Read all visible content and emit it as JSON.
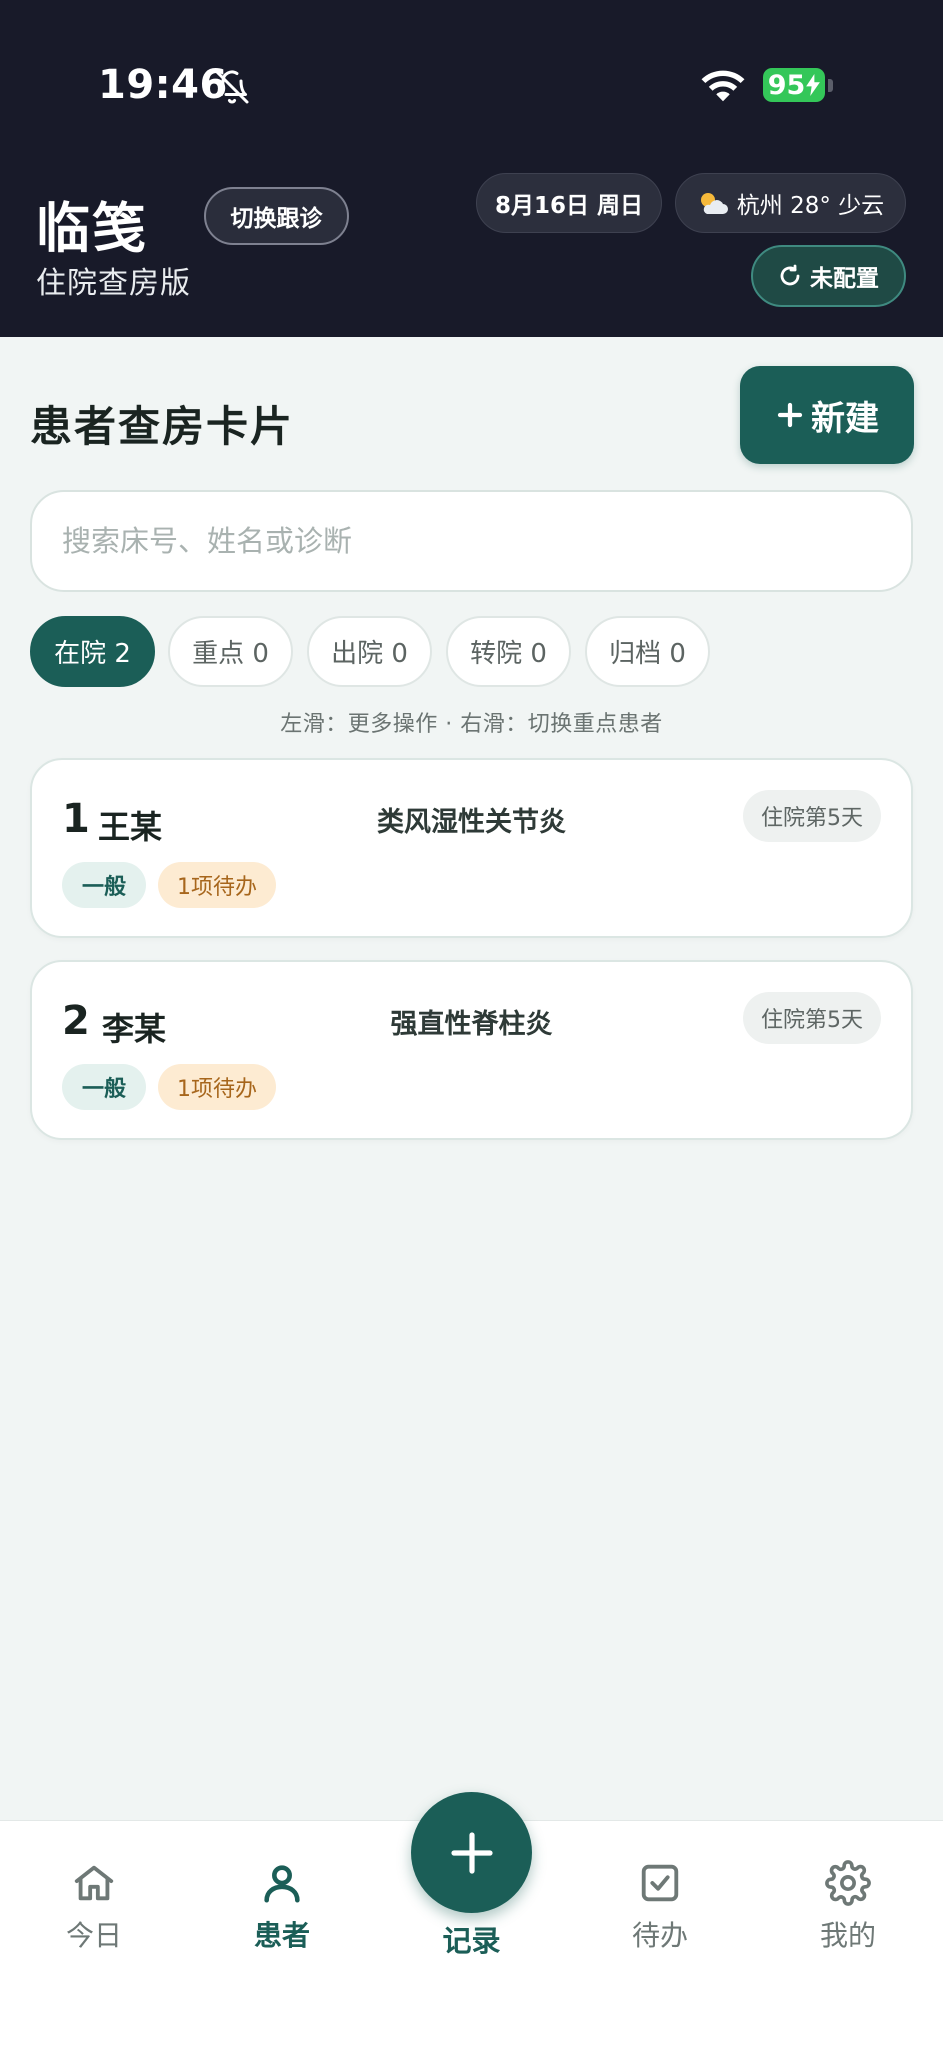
{
  "status_bar": {
    "time": "19:46",
    "battery": "95",
    "icons": [
      "bell-off-icon",
      "wifi-icon",
      "battery-icon",
      "bolt-icon"
    ]
  },
  "header": {
    "title": "临笺",
    "subtitle": "住院查房版",
    "switch_button": "切换跟诊",
    "date": "8月16日 周日",
    "weather": "杭州 28° 少云",
    "config_button": "未配置"
  },
  "main": {
    "section_title": "患者查房卡片",
    "new_button": "新建",
    "search": {
      "placeholder": "搜索床号、姓名或诊断",
      "value": ""
    },
    "filters": [
      {
        "label": "在院 2",
        "active": true
      },
      {
        "label": "重点 0",
        "active": false
      },
      {
        "label": "出院 0",
        "active": false
      },
      {
        "label": "转院 0",
        "active": false
      },
      {
        "label": "归档 0",
        "active": false
      }
    ],
    "hint": "左滑：更多操作  ·  右滑：切换重点患者",
    "patients": [
      {
        "bed": "1",
        "name": "王某",
        "diagnosis": "类风湿性关节炎",
        "days": "住院第5天",
        "level": "一般",
        "todo": "1项待办"
      },
      {
        "bed": "2",
        "name": "李某",
        "diagnosis": "强直性脊柱炎",
        "days": "住院第5天",
        "level": "一般",
        "todo": "1项待办"
      }
    ]
  },
  "bottom_nav": {
    "items": [
      {
        "label": "今日",
        "icon": "home-icon",
        "active": false
      },
      {
        "label": "患者",
        "icon": "user-icon",
        "active": true
      },
      {
        "label": "记录",
        "icon": "plus-icon",
        "active": false
      },
      {
        "label": "待办",
        "icon": "checkbox-icon",
        "active": false
      },
      {
        "label": "我的",
        "icon": "gear-icon",
        "active": false
      }
    ]
  },
  "colors": {
    "header_bg": "#181a29",
    "accent": "#1b5e57",
    "page_bg": "#f1f5f4",
    "todo_tag_bg": "#fdebd2",
    "todo_tag_text": "#a7661c",
    "battery": "#34c759"
  }
}
